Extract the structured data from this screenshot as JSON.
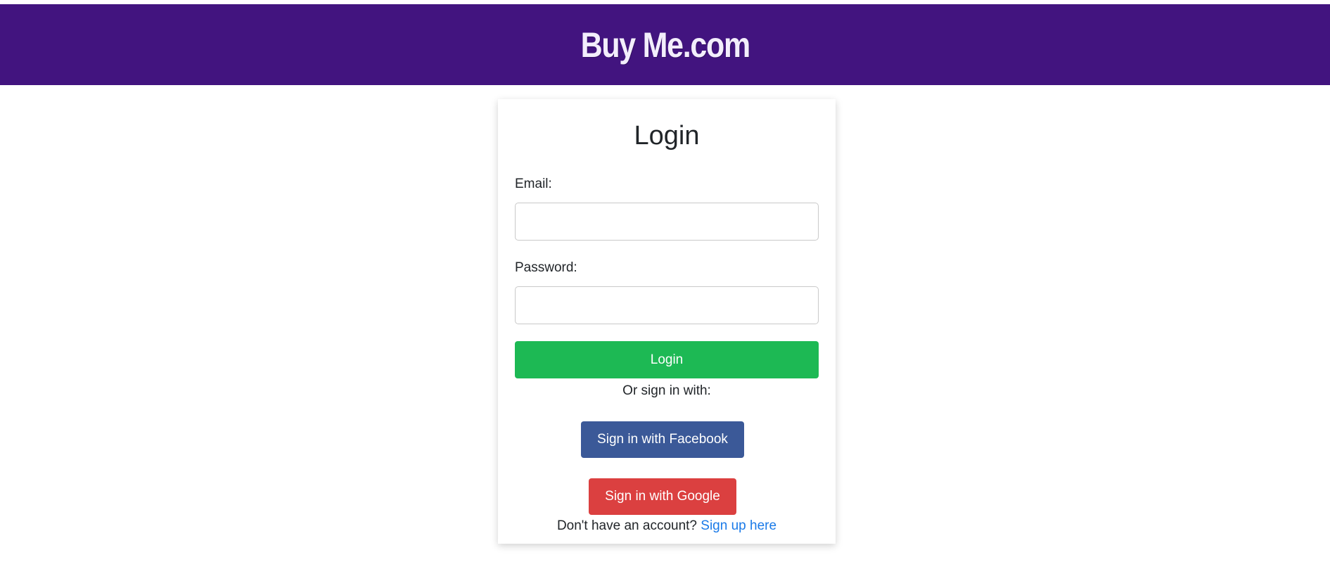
{
  "header": {
    "brand": "Buy Me.com"
  },
  "login_form": {
    "title": "Login",
    "email_label": "Email:",
    "email_value": "",
    "password_label": "Password:",
    "password_value": "",
    "login_button": "Login",
    "or_text": "Or sign in with:",
    "facebook_button": "Sign in with Facebook",
    "google_button": "Sign in with Google",
    "signup_prompt": "Don't have an account?",
    "signup_link": "Sign up here"
  },
  "colors": {
    "header_bg": "#42147f",
    "login_button": "#1db954",
    "facebook_button": "#3b5998",
    "google_button": "#db4040",
    "link": "#1a7ae8"
  }
}
